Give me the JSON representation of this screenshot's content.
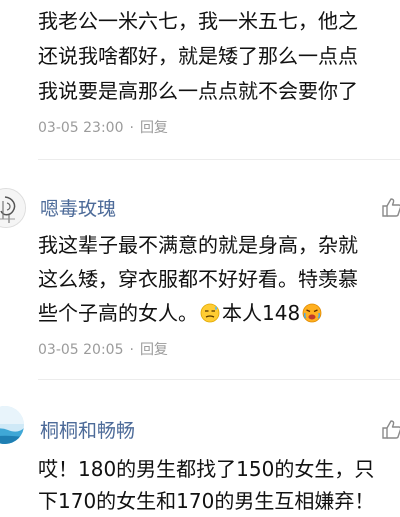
{
  "comments": [
    {
      "lines": [
        "我老公一米六七，我一米五七，他之",
        "还说我啥都好，就是矮了那么一点点",
        "我说要是高那么一点点就不会要你了"
      ],
      "date": "03-05 23:00",
      "reply_label": "回复"
    },
    {
      "username": "嗯毒玫瑰",
      "avatar_icon": "rose-sketch-avatar",
      "lines": [
        "我这辈子最不满意的就是身高，杂就",
        "这么矮，穿衣服都不好好看。特羡慕",
        "些个子高的女人。",
        "本人148"
      ],
      "emojis": [
        "awkward-sweat-face-emoji",
        "crying-face-emoji"
      ],
      "date": "03-05 20:05",
      "reply_label": "回复"
    },
    {
      "username": "桐桐和畅畅",
      "avatar_icon": "sky-landscape-avatar",
      "lines": [
        "哎！180的男生都找了150的女生，只",
        "下170的女生和170的男生互相嫌弃！"
      ]
    }
  ],
  "icons": {
    "like": "thumbs-up-icon"
  },
  "colors": {
    "username": "#4d6b99",
    "meta": "#9b9b9b",
    "text": "#111111"
  }
}
